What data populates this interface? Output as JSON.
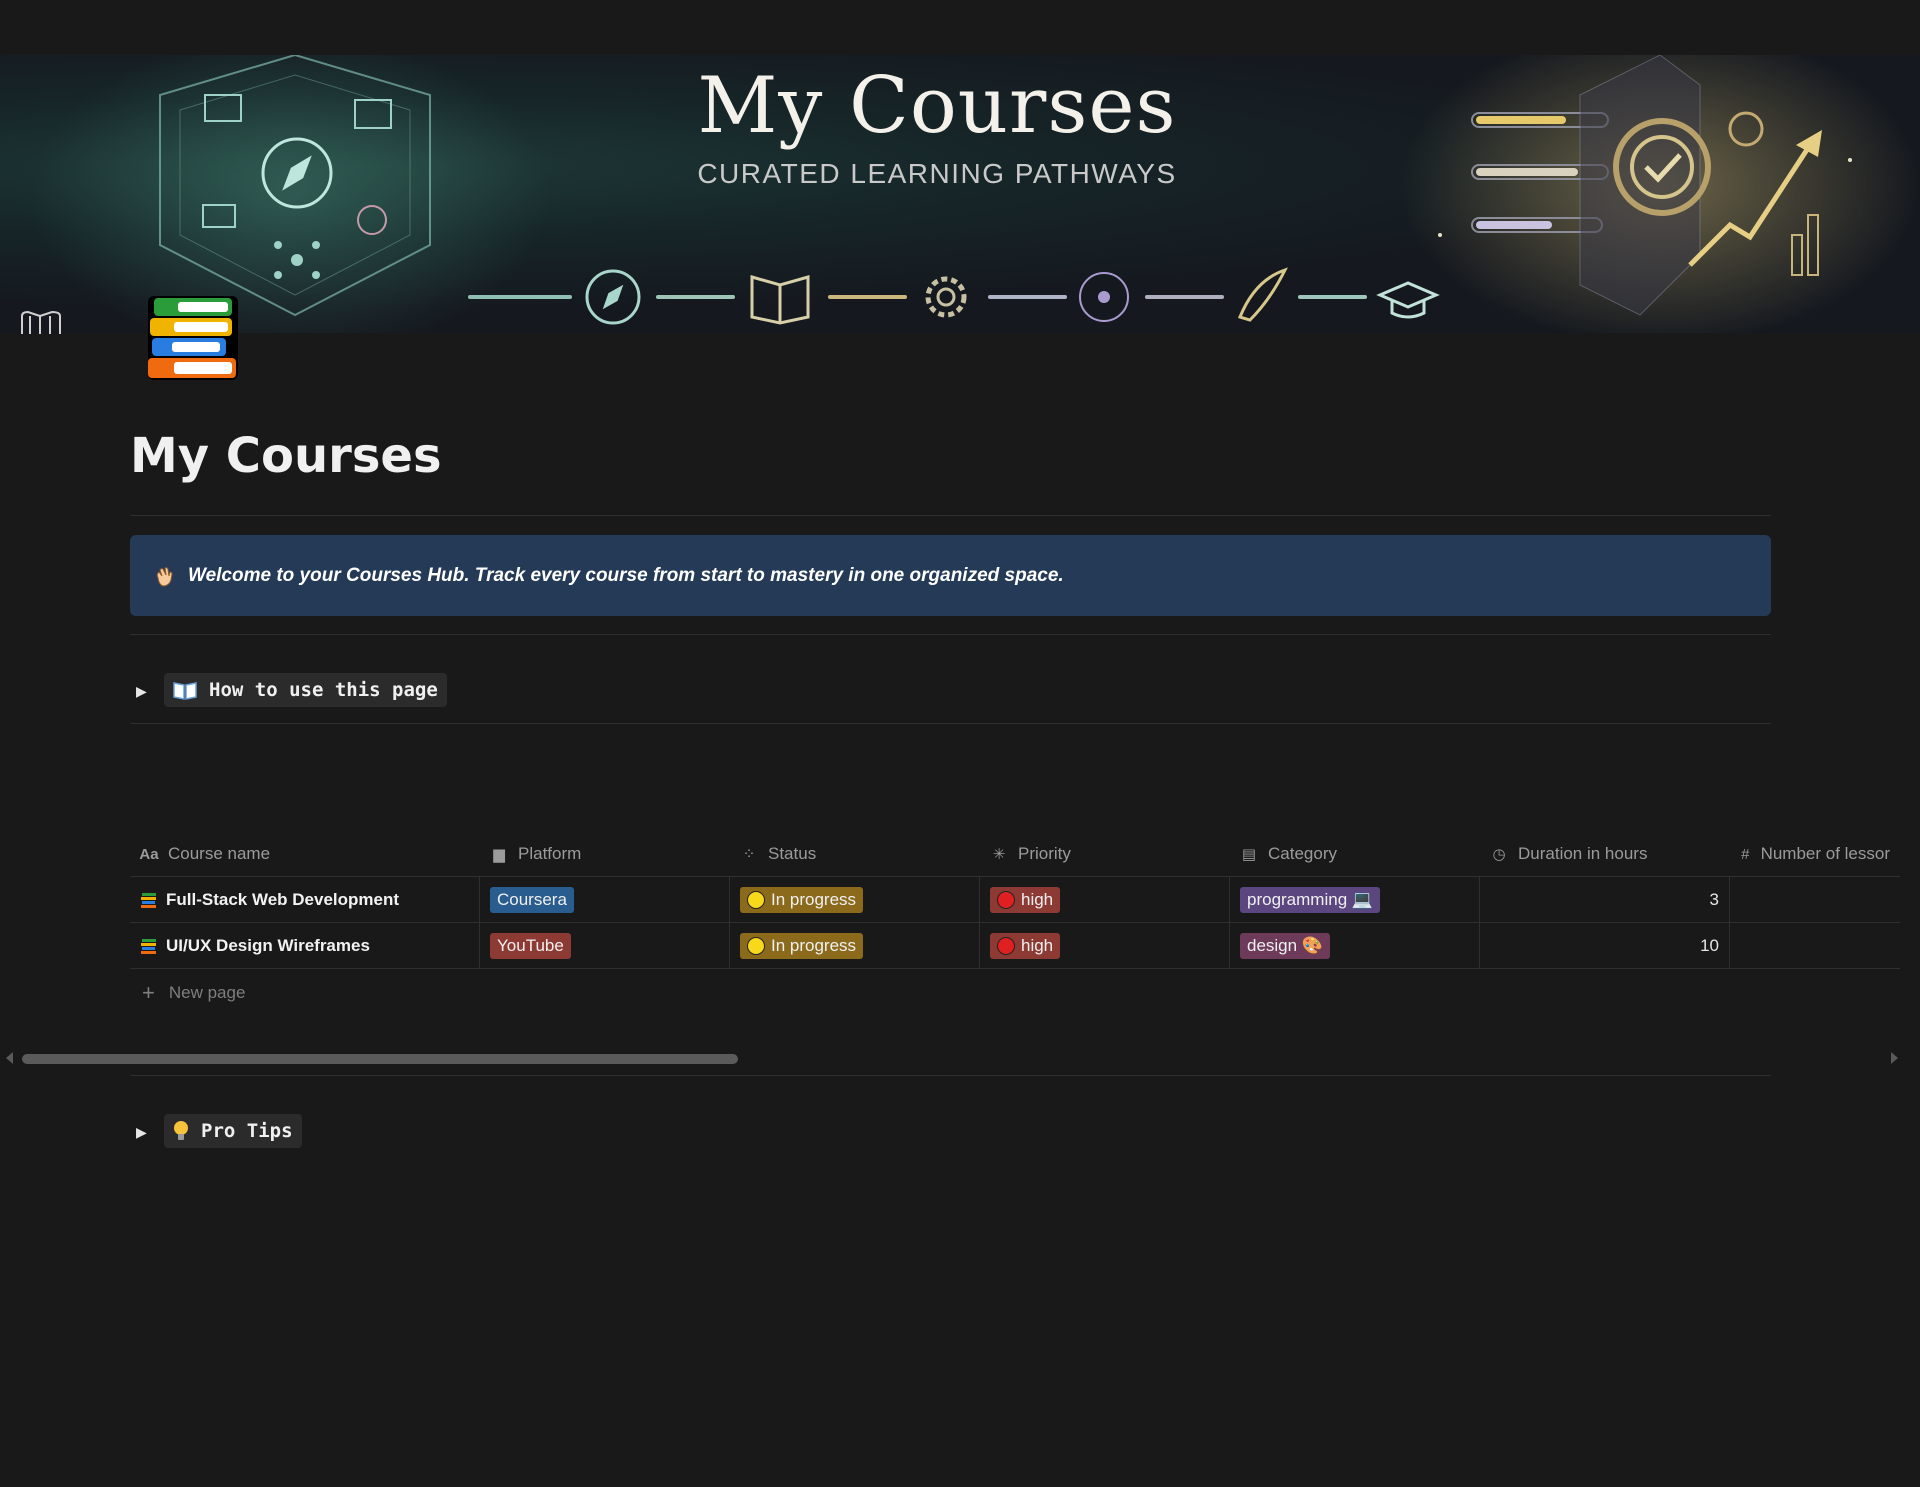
{
  "cover": {
    "title": "My Courses",
    "subtitle": "CURATED LEARNING PATHWAYS"
  },
  "page": {
    "icon": "books-icon",
    "title": "My Courses"
  },
  "callout": {
    "icon": "waving-hand-icon",
    "text": "Welcome to your Courses Hub. Track every course from start to mastery in one organized space."
  },
  "toggles": [
    {
      "icon": "open-book-icon",
      "label": "How to use this page"
    },
    {
      "icon": "light-bulb-icon",
      "label": "Pro Tips"
    }
  ],
  "table": {
    "columns": [
      {
        "icon": "text-icon",
        "label": "Course name"
      },
      {
        "icon": "book-icon",
        "label": "Platform"
      },
      {
        "icon": "status-icon",
        "label": "Status"
      },
      {
        "icon": "priority-icon",
        "label": "Priority"
      },
      {
        "icon": "archive-icon",
        "label": "Category"
      },
      {
        "icon": "clock-icon",
        "label": "Duration in hours"
      },
      {
        "icon": "hash-icon",
        "label": "Number of lessor"
      }
    ],
    "rows": [
      {
        "name": "Full-Stack Web Development",
        "platform": "Coursera",
        "platform_color": "#295c8f",
        "status": "In progress",
        "priority": "high",
        "category": "programming 💻",
        "category_color": "#5b4680",
        "duration": "3",
        "lessons": ""
      },
      {
        "name": "UI/UX Design Wireframes",
        "platform": "YouTube",
        "platform_color": "#8d3a34",
        "status": "In progress",
        "priority": "high",
        "category": "design 🎨",
        "category_color": "#6e3a5a",
        "duration": "10",
        "lessons": ""
      }
    ],
    "new_page_label": "New page"
  },
  "colors": {
    "background": "#191919",
    "callout_bg": "#243a56",
    "status_yellow": "#8b6a1c",
    "priority_red": "#8d3a34"
  }
}
